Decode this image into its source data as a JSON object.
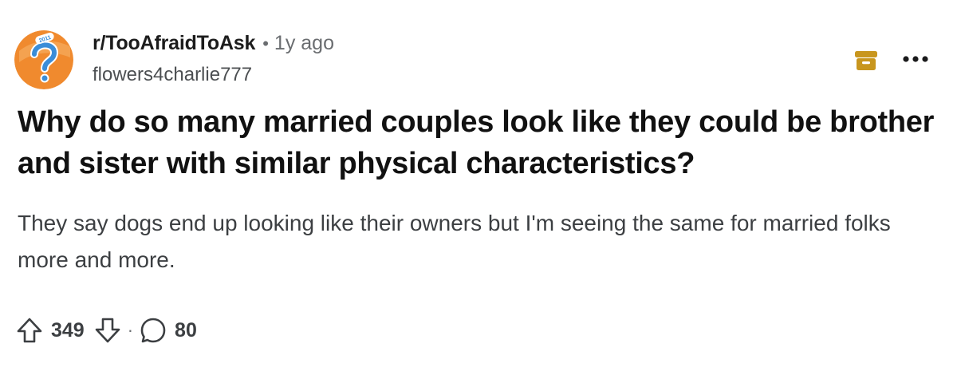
{
  "post": {
    "subreddit": "r/TooAfraidToAsk",
    "separator": "•",
    "time": "1y ago",
    "author": "flowers4charlie777",
    "title": "Why do so many married couples look like they could be brother and sister with similar physical characteristics?",
    "body": "They say dogs end up looking like their owners but I'm seeing the same for married folks more and more.",
    "avatar_badge": "2011"
  },
  "actions": {
    "upvotes": "349",
    "separator": "·",
    "comments": "80"
  },
  "icons": {
    "avatar": "question-mark-avatar",
    "archive": "archive-icon",
    "more": "more-options-icon",
    "upvote": "upvote-arrow-icon",
    "downvote": "downvote-arrow-icon",
    "comment": "comment-bubble-icon"
  },
  "colors": {
    "archive_accent": "#c8961e",
    "avatar_orange": "#f08a2e",
    "avatar_blue": "#3a8dd8"
  }
}
